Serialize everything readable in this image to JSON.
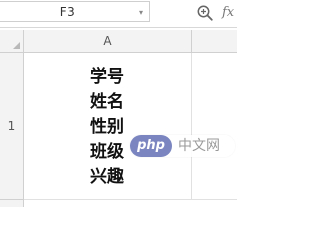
{
  "name_box": {
    "value": "F3",
    "dropdown_icon": "chevron-down-icon"
  },
  "formula_bar": {
    "zoom_icon": "zoom-icon",
    "fx_label": "fx"
  },
  "column_headers": [
    "A"
  ],
  "row_headers": [
    "1"
  ],
  "cell_a1": {
    "lines": [
      "学号",
      "姓名",
      "性别",
      "班级",
      "兴趣"
    ]
  },
  "watermark": {
    "badge": "php",
    "text": "中文网"
  },
  "colors": {
    "header_bg": "#f3f3f3",
    "grid_line": "#d0d0d0",
    "watermark_badge": "#7b86c1"
  }
}
